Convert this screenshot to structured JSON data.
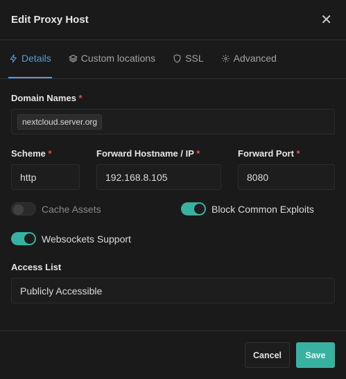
{
  "modal": {
    "title": "Edit Proxy Host"
  },
  "tabs": [
    {
      "label": "Details",
      "icon": "lightning-icon",
      "active": true
    },
    {
      "label": "Custom locations",
      "icon": "layers-icon",
      "active": false
    },
    {
      "label": "SSL",
      "icon": "shield-icon",
      "active": false
    },
    {
      "label": "Advanced",
      "icon": "gear-icon",
      "active": false
    }
  ],
  "form": {
    "domain_names": {
      "label": "Domain Names",
      "required": "*",
      "values": [
        "nextcloud.server.org"
      ]
    },
    "scheme": {
      "label": "Scheme",
      "required": "*",
      "value": "http"
    },
    "forward_hostname": {
      "label": "Forward Hostname / IP",
      "required": "*",
      "value": "192.168.8.105"
    },
    "forward_port": {
      "label": "Forward Port",
      "required": "*",
      "value": "8080"
    },
    "cache_assets": {
      "label": "Cache Assets",
      "enabled": false
    },
    "block_exploits": {
      "label": "Block Common Exploits",
      "enabled": true
    },
    "websockets": {
      "label": "Websockets Support",
      "enabled": true
    },
    "access_list": {
      "label": "Access List",
      "value": "Publicly Accessible"
    }
  },
  "footer": {
    "cancel_label": "Cancel",
    "save_label": "Save"
  },
  "colors": {
    "accent": "#5b9bd5",
    "toggle_on": "#38b2a0",
    "required": "#e0525c"
  }
}
